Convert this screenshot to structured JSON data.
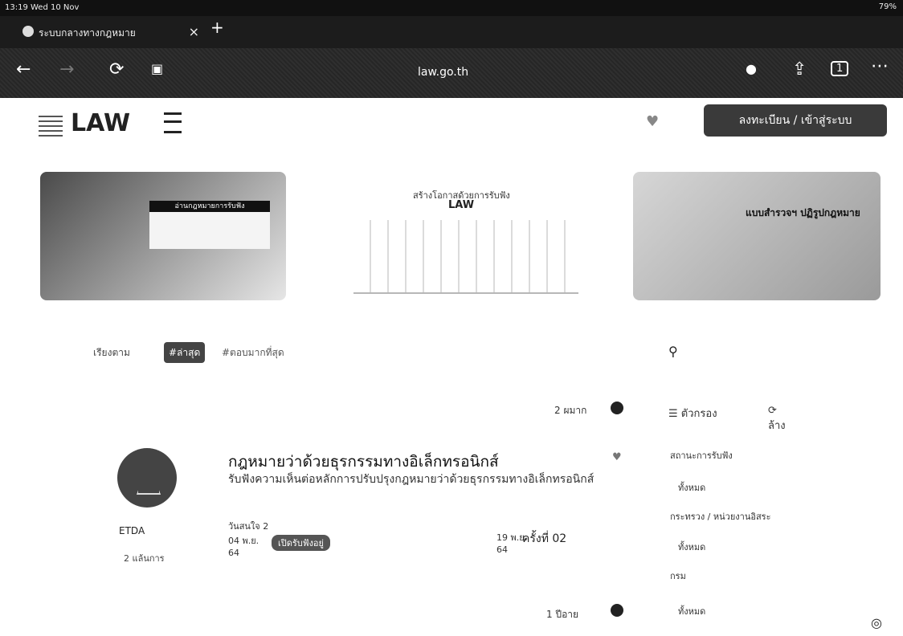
{
  "status": {
    "time": "13:19  Wed 10 Nov",
    "battery": "79%"
  },
  "browser": {
    "tab_title": "ระบบกลางทางกฎหมาย",
    "tab_close": "×",
    "new_tab": "+",
    "url": "law.go.th",
    "tab_count": "1"
  },
  "header": {
    "logo": "LAW",
    "login_button": "ลงทะเบียน / เข้าสู่ระบบ"
  },
  "banners": {
    "b1_label": "อ่านกฎหมายการรับฟัง",
    "b2_line1": "สร้างโอกาสด้วยการรับฟัง",
    "b2_line2": "LAW",
    "b3_title": "แบบสำรวจฯ ปฏิรูปกฎหมาย"
  },
  "filters": {
    "prefix": "เรียงตาม",
    "latest": "#ล่าสุด",
    "popular": "#ตอบมากที่สุด"
  },
  "search": {
    "icon": "search-icon"
  },
  "posts": [
    {
      "count": "2 ผมาก",
      "title": "กฎหมายว่าด้วยธุรกรรมทางอิเล็กทรอนิกส์",
      "desc": "รับฟังความเห็นต่อหลักการปรับปรุงกฎหมายว่าด้วยธุรกรรมทางอิเล็กทรอนิกส์",
      "org": "ETDA",
      "org_sub": "2 แล้นการ",
      "meta": "วันสนใจ 2",
      "date_start": "04 พ.ย.",
      "date_start_year": "64",
      "status_pill": "เปิดรับฟังอยู่",
      "date_end": "19 พ.ย.",
      "date_end_year": "64",
      "round": "ครั้งที่ 02"
    }
  ],
  "next_count": "1 ปีอาย",
  "sidebar": {
    "filter_label": "ตัวกรอง",
    "reset_label": "ล้าง",
    "status_label": "สถานะการรับฟัง",
    "status_value": "ทั้งหมด",
    "ministry_label": "กระทรวง / หน่วยงานอิสระ",
    "ministry_value": "ทั้งหมด",
    "dept_label": "กรม",
    "dept_value": "ทั้งหมด"
  }
}
